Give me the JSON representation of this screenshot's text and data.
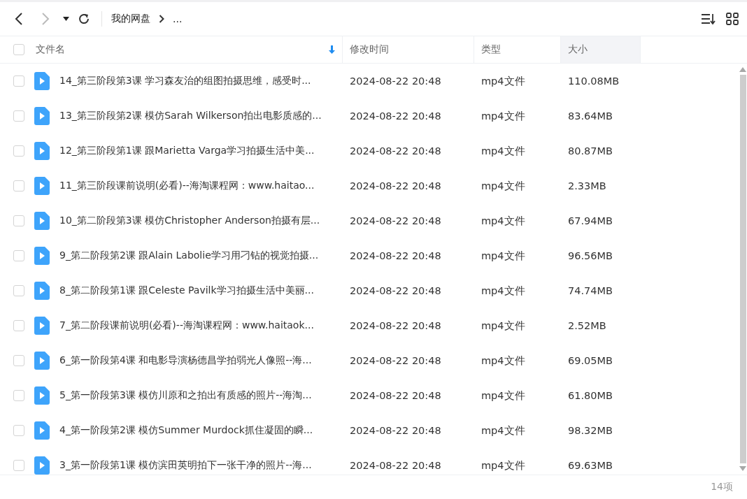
{
  "toolbar": {
    "breadcrumb": [
      "我的网盘",
      "..."
    ],
    "back_disabled": false,
    "forward_disabled": true
  },
  "columns": [
    {
      "label": "文件名",
      "sorted": true,
      "hovered": false
    },
    {
      "label": "修改时间",
      "sorted": false,
      "hovered": false
    },
    {
      "label": "类型",
      "sorted": false,
      "hovered": false
    },
    {
      "label": "大小",
      "sorted": false,
      "hovered": true
    }
  ],
  "header_checked": false,
  "rows": [
    {
      "name": "14_第三阶段第3课 学习森友治的组图拍摄思维，感受时...",
      "modified": "2024-08-22 20:48",
      "type": "mp4文件",
      "size": "110.08MB",
      "checked": false
    },
    {
      "name": "13_第三阶段第2课 模仿Sarah Wilkerson拍出电影质感的...",
      "modified": "2024-08-22 20:48",
      "type": "mp4文件",
      "size": "83.64MB",
      "checked": false
    },
    {
      "name": "12_第三阶段第1课 跟Marietta Varga学习拍摄生活中美...",
      "modified": "2024-08-22 20:48",
      "type": "mp4文件",
      "size": "80.87MB",
      "checked": false
    },
    {
      "name": "11_第三阶段课前说明(必看)--海淘课程网：www.haitao...",
      "modified": "2024-08-22 20:48",
      "type": "mp4文件",
      "size": "2.33MB",
      "checked": false
    },
    {
      "name": "10_第二阶段第3课 模仿Christopher Anderson拍摄有层...",
      "modified": "2024-08-22 20:48",
      "type": "mp4文件",
      "size": "67.94MB",
      "checked": false
    },
    {
      "name": "9_第二阶段第2课 跟Alain Labolie学习用刁钻的视觉拍摄...",
      "modified": "2024-08-22 20:48",
      "type": "mp4文件",
      "size": "96.56MB",
      "checked": false
    },
    {
      "name": "8_第二阶段第1课 跟Celeste Pavilk学习拍摄生活中美丽...",
      "modified": "2024-08-22 20:48",
      "type": "mp4文件",
      "size": "74.74MB",
      "checked": false
    },
    {
      "name": "7_第二阶段课前说明(必看)--海淘课程网：www.haitaok...",
      "modified": "2024-08-22 20:48",
      "type": "mp4文件",
      "size": "2.52MB",
      "checked": false
    },
    {
      "name": "6_第一阶段第4课 和电影导演杨德昌学拍弱光人像照--海...",
      "modified": "2024-08-22 20:48",
      "type": "mp4文件",
      "size": "69.05MB",
      "checked": false
    },
    {
      "name": "5_第一阶段第3课 模仿川原和之拍出有质感的照片--海淘...",
      "modified": "2024-08-22 20:48",
      "type": "mp4文件",
      "size": "61.80MB",
      "checked": false
    },
    {
      "name": "4_第一阶段第2课 模仿Summer Murdock抓住凝固的瞬...",
      "modified": "2024-08-22 20:48",
      "type": "mp4文件",
      "size": "98.32MB",
      "checked": false
    },
    {
      "name": "3_第一阶段第1课 模仿滨田英明拍下一张干净的照片--海...",
      "modified": "2024-08-22 20:48",
      "type": "mp4文件",
      "size": "69.63MB",
      "checked": false
    }
  ],
  "status_bar": {
    "count": "14项"
  }
}
